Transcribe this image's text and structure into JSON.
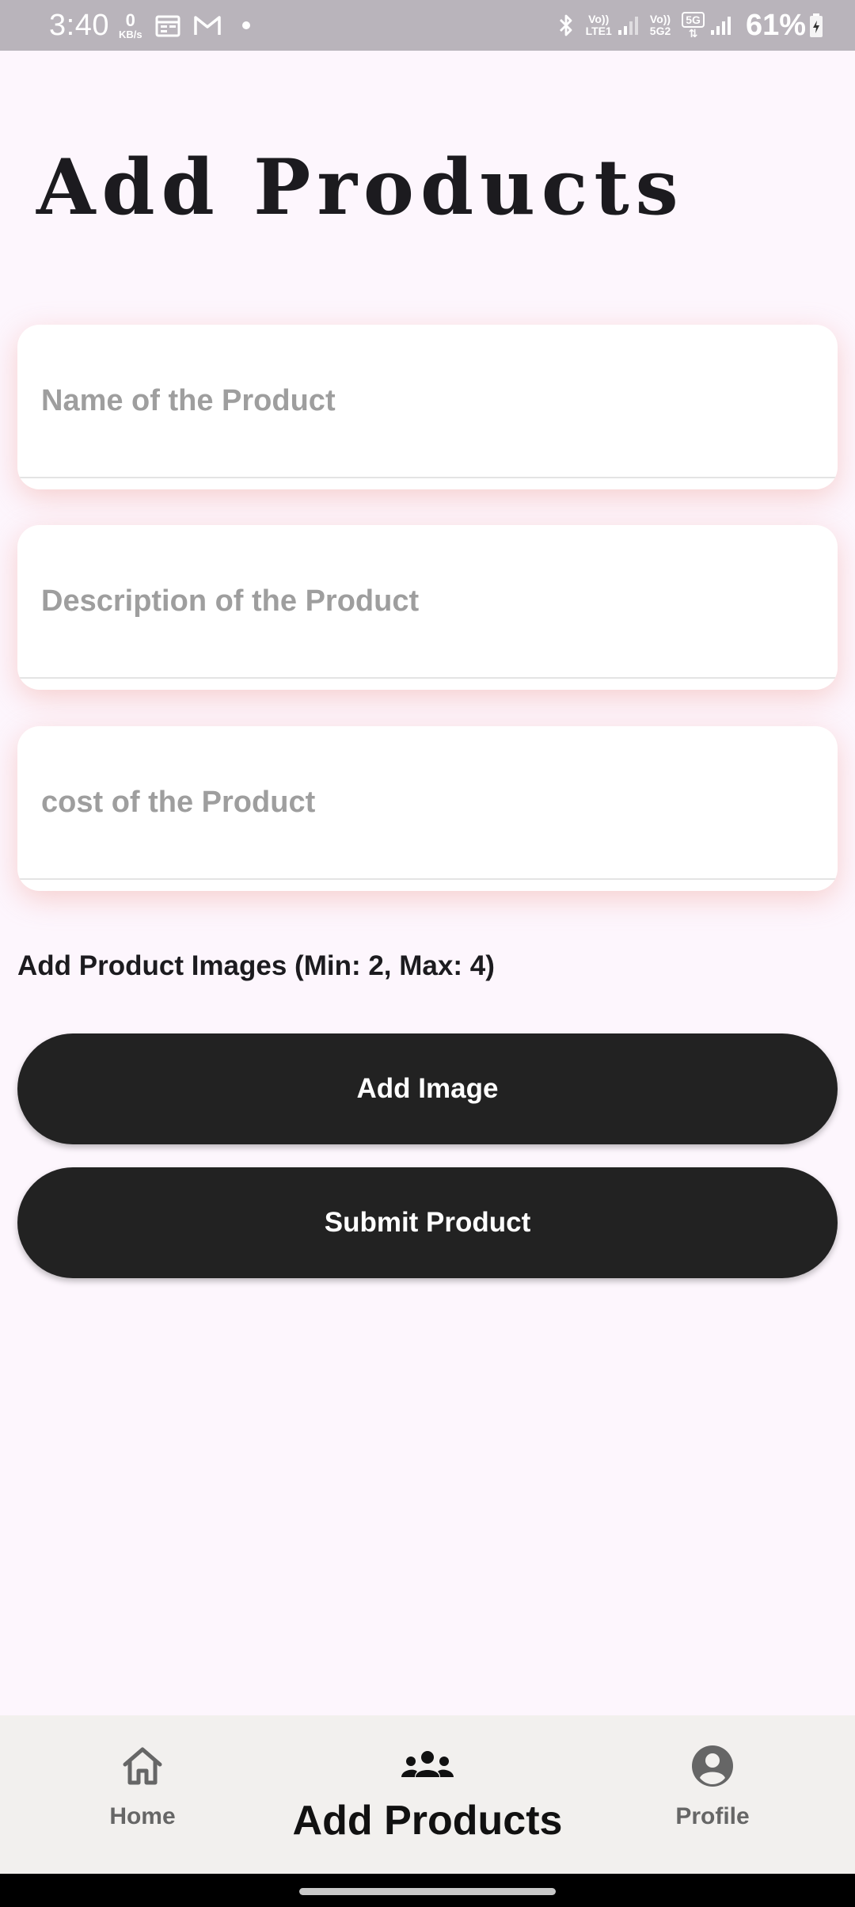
{
  "status_bar": {
    "time": "3:40",
    "speed_value": "0",
    "speed_unit": "KB/s",
    "net1_top": "Vo))",
    "net1_bottom": "LTE1",
    "net2_top": "Vo))",
    "net2_bottom": "5G2",
    "net2_badge": "5G",
    "battery": "61%"
  },
  "page": {
    "title": "Add Products"
  },
  "form": {
    "name_placeholder": "Name of the Product",
    "description_placeholder": "Description of the Product",
    "cost_placeholder": "cost of the Product",
    "images_label": "Add Product Images (Min: 2, Max: 4)",
    "add_image_label": "Add Image",
    "submit_label": "Submit Product"
  },
  "bottom_nav": {
    "items": [
      {
        "label": "Home",
        "icon": "home-icon",
        "active": false
      },
      {
        "label": "Add Products",
        "icon": "group-icon",
        "active": true
      },
      {
        "label": "Profile",
        "icon": "account-circle-icon",
        "active": false
      }
    ]
  },
  "colors": {
    "background": "#fdf6fd",
    "button": "#222222",
    "nav_background": "#f2f0ee",
    "card_shadow": "#f0a096"
  }
}
